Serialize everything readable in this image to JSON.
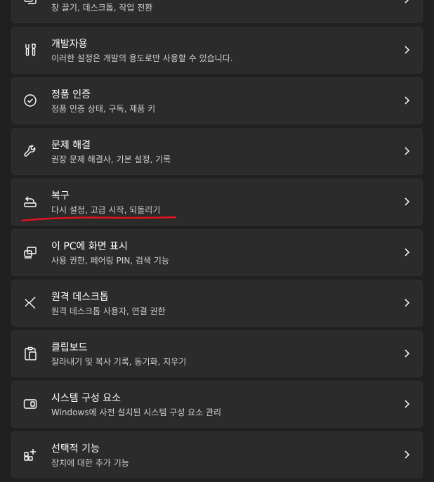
{
  "settings_items": [
    {
      "title": "",
      "subtitle": "창 끌기, 데스크톱, 작업 전환",
      "icon": "multitasking-icon"
    },
    {
      "title": "개발자용",
      "subtitle": "이러한 설정은 개발의 용도로만 사용할 수 있습니다.",
      "icon": "developer-tools-icon"
    },
    {
      "title": "정품 인증",
      "subtitle": "정품 인증 상태, 구독, 제품 키",
      "icon": "activation-check-icon"
    },
    {
      "title": "문제 해결",
      "subtitle": "권장 문제 해결사, 기본 설정, 기록",
      "icon": "wrench-icon"
    },
    {
      "title": "복구",
      "subtitle": "다시 설정, 고급 시작, 되돌리기",
      "icon": "recovery-icon"
    },
    {
      "title": "이 PC에 화면 표시",
      "subtitle": "사용 권한, 페어링 PIN, 검색 기능",
      "icon": "project-to-pc-icon"
    },
    {
      "title": "원격 데스크톱",
      "subtitle": "원격 데스크톱 사용자, 연결 권한",
      "icon": "remote-desktop-icon"
    },
    {
      "title": "클립보드",
      "subtitle": "잘라내기 및 복사 기록, 동기화, 지우기",
      "icon": "clipboard-icon"
    },
    {
      "title": "시스템 구성 요소",
      "subtitle": "Windows에 사전 설치된 시스템 구성 요소 관리",
      "icon": "system-components-icon"
    },
    {
      "title": "선택적 기능",
      "subtitle": "장치에 대한 추가 기능",
      "icon": "optional-features-icon"
    }
  ],
  "colors": {
    "background": "#202020",
    "card": "#2b2b2b",
    "annotation_underline": "#e0141e"
  }
}
